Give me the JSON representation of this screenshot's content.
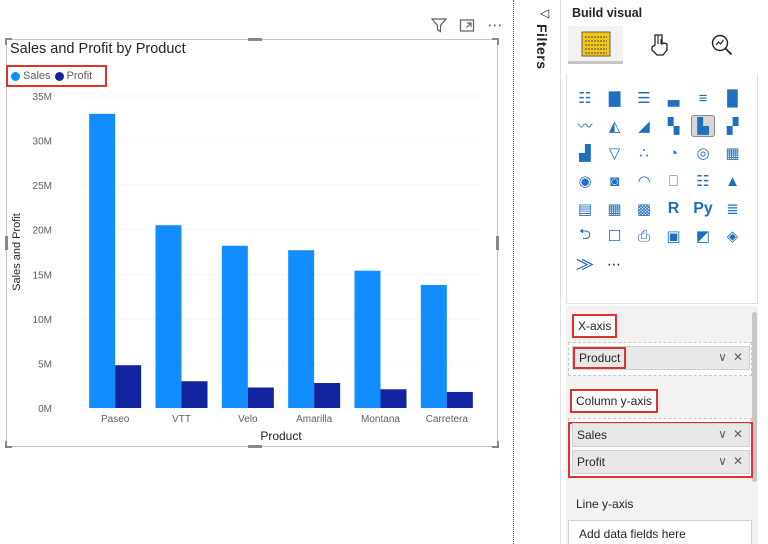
{
  "visual": {
    "title": "Sales and Profit by Product",
    "header_icons": [
      "filter-icon",
      "focus-mode-icon",
      "more-options-icon"
    ],
    "more_glyph": "⋯"
  },
  "chart_data": {
    "type": "bar",
    "title": "Sales and Profit by Product",
    "xlabel": "Product",
    "ylabel": "Sales and Profit",
    "categories": [
      "Paseo",
      "VTT",
      "Velo",
      "Amarilla",
      "Montana",
      "Carretera"
    ],
    "series": [
      {
        "name": "Sales",
        "color": "#118dff",
        "values": [
          33,
          20.5,
          18.2,
          17.7,
          15.4,
          13.8
        ]
      },
      {
        "name": "Profit",
        "color": "#12239e",
        "values": [
          4.8,
          3.0,
          2.3,
          2.8,
          2.1,
          1.8
        ]
      }
    ],
    "ylim": [
      0,
      35
    ],
    "yticks": [
      0,
      5,
      10,
      15,
      20,
      25,
      30,
      35
    ],
    "ytick_labels": [
      "0M",
      "5M",
      "10M",
      "15M",
      "20M",
      "25M",
      "30M",
      "35M"
    ],
    "grid": true,
    "legend": "top-left"
  },
  "filters": {
    "label": "Filters",
    "collapse_glyph": "◁"
  },
  "build": {
    "title": "Build visual",
    "tabs": [
      {
        "name": "add-visual-tab-icon",
        "active": true
      },
      {
        "name": "format-visual-tab-icon",
        "active": false
      },
      {
        "name": "analytics-tab-icon",
        "active": false
      }
    ],
    "gallery_icons": [
      {
        "name": "stacked-bar-chart-icon",
        "glyph": "☷"
      },
      {
        "name": "stacked-column-chart-icon",
        "glyph": "▇"
      },
      {
        "name": "clustered-bar-chart-icon",
        "glyph": "☰"
      },
      {
        "name": "clustered-column-chart-icon",
        "glyph": "▃"
      },
      {
        "name": "100-stacked-bar-chart-icon",
        "glyph": "≡"
      },
      {
        "name": "100-stacked-column-chart-icon",
        "glyph": "█"
      },
      {
        "name": "line-chart-icon",
        "glyph": "〰"
      },
      {
        "name": "area-chart-icon",
        "glyph": "◭"
      },
      {
        "name": "stacked-area-chart-icon",
        "glyph": "◢"
      },
      {
        "name": "line-and-stacked-column-chart-icon",
        "glyph": "▚"
      },
      {
        "name": "line-and-clustered-column-chart-icon",
        "glyph": "▙",
        "selected": true
      },
      {
        "name": "ribbon-chart-icon",
        "glyph": "▞"
      },
      {
        "name": "waterfall-chart-icon",
        "glyph": "▟"
      },
      {
        "name": "funnel-chart-icon",
        "glyph": "▽"
      },
      {
        "name": "scatter-chart-icon",
        "glyph": "∴"
      },
      {
        "name": "pie-chart-icon",
        "glyph": "◔"
      },
      {
        "name": "donut-chart-icon",
        "glyph": "◎"
      },
      {
        "name": "treemap-icon",
        "glyph": "▦"
      },
      {
        "name": "map-icon",
        "glyph": "◉"
      },
      {
        "name": "filled-map-icon",
        "glyph": "◙"
      },
      {
        "name": "gauge-icon",
        "glyph": "◠"
      },
      {
        "name": "card-icon",
        "glyph": "⎕"
      },
      {
        "name": "multi-row-card-icon",
        "glyph": "☷"
      },
      {
        "name": "kpi-icon",
        "glyph": "▲"
      },
      {
        "name": "slicer-icon",
        "glyph": "▤"
      },
      {
        "name": "table-icon",
        "glyph": "▦"
      },
      {
        "name": "matrix-icon",
        "glyph": "▩"
      },
      {
        "name": "r-visual-icon",
        "glyph": "R",
        "text": true
      },
      {
        "name": "python-visual-icon",
        "glyph": "Py",
        "text": true
      },
      {
        "name": "key-influencers-icon",
        "glyph": "≣"
      },
      {
        "name": "decomposition-tree-icon",
        "glyph": "⮌"
      },
      {
        "name": "qa-icon",
        "glyph": "☐"
      },
      {
        "name": "smart-narrative-icon",
        "glyph": "⎙"
      },
      {
        "name": "paginated-report-icon",
        "glyph": "▣"
      },
      {
        "name": "power-apps-icon",
        "glyph": "◩"
      },
      {
        "name": "power-automate-icon",
        "glyph": "◈"
      },
      {
        "name": "metrics-icon",
        "glyph": "⨠"
      },
      {
        "name": "more-visuals-icon",
        "glyph": "⋯",
        "more": true
      }
    ],
    "x_axis": {
      "label": "X-axis",
      "fields": [
        "Product"
      ]
    },
    "column_y_axis": {
      "label": "Column y-axis",
      "fields": [
        "Sales",
        "Profit"
      ]
    },
    "line_y_axis": {
      "label": "Line y-axis",
      "placeholder": "Add data fields here"
    },
    "pill_chevron": "∨",
    "pill_close": "✕"
  }
}
